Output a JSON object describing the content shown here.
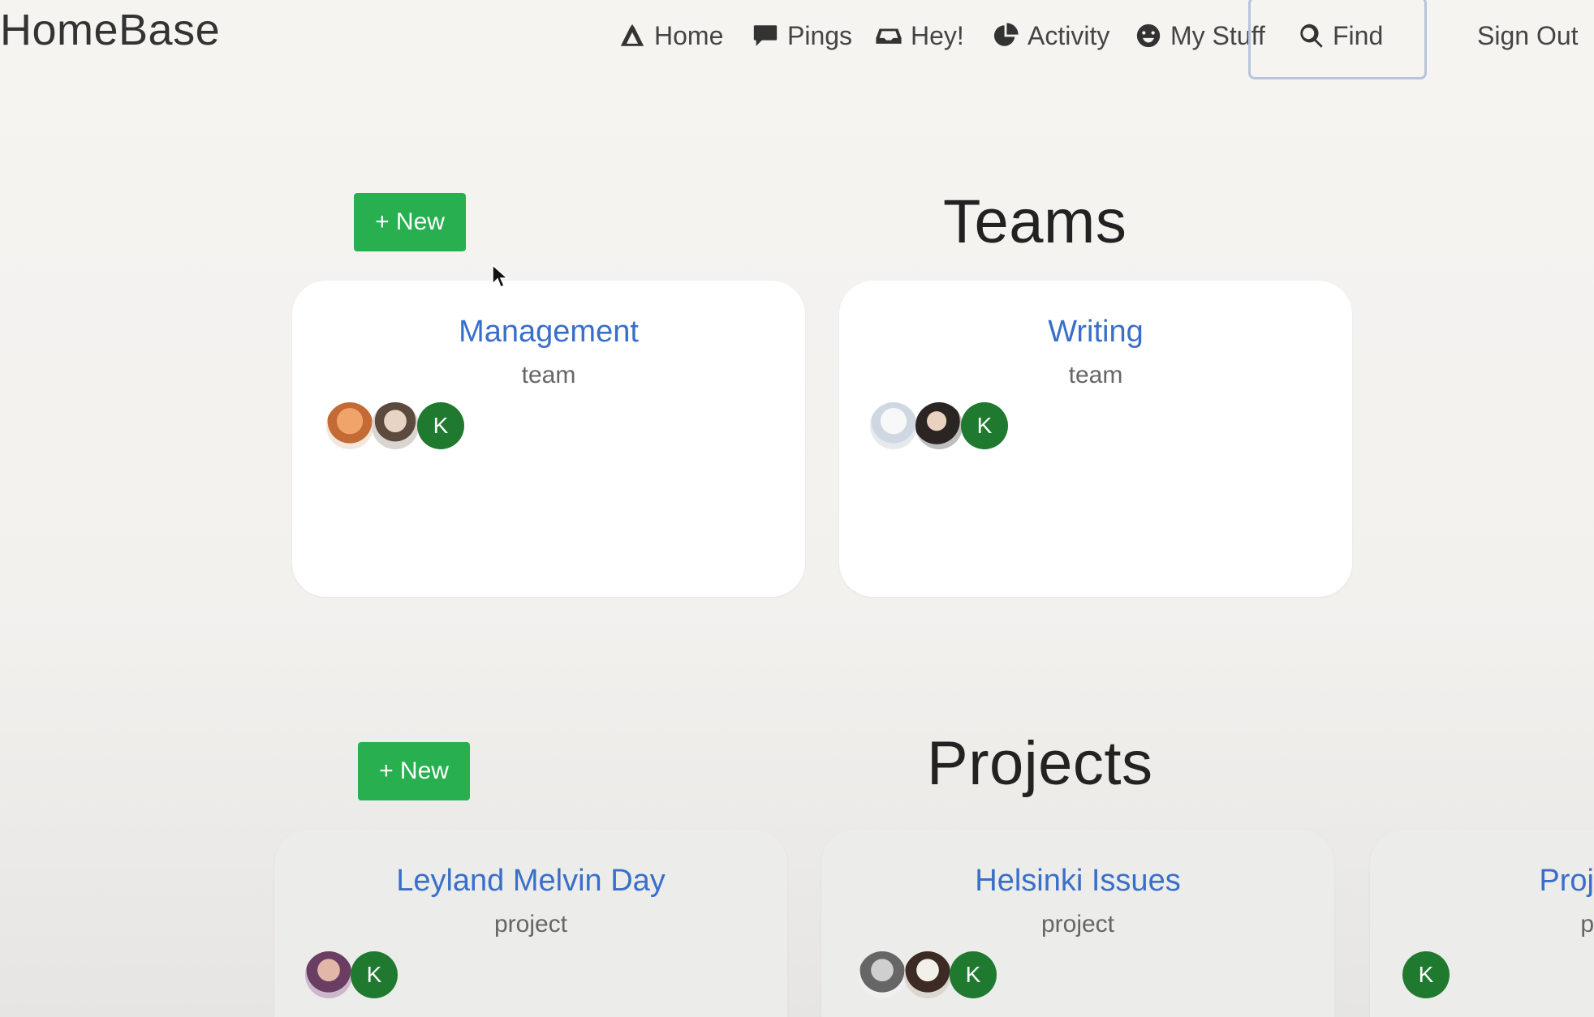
{
  "brand": "HomeBase",
  "nav": [
    {
      "label": "Home",
      "icon": "tent-icon"
    },
    {
      "label": "Pings",
      "icon": "chat-bubble-icon"
    },
    {
      "label": "Hey!",
      "icon": "inbox-icon"
    },
    {
      "label": "Activity",
      "icon": "pie-chart-icon"
    },
    {
      "label": "My Stuff",
      "icon": "smiley-icon"
    },
    {
      "label": "Find",
      "icon": "search-icon"
    }
  ],
  "sign_out": "Sign Out",
  "teams": {
    "title": "Teams",
    "new_label": "+ New",
    "cards": [
      {
        "title": "Management",
        "type": "team",
        "initial": "K"
      },
      {
        "title": "Writing",
        "type": "team",
        "initial": "K"
      }
    ]
  },
  "projects": {
    "title": "Projects",
    "new_label": "+ New",
    "cards": [
      {
        "title": "Leyland Melvin Day",
        "type": "project",
        "initial": "K"
      },
      {
        "title": "Helsinki Issues",
        "type": "project",
        "initial": "K"
      },
      {
        "title": "Proj",
        "type": "p",
        "initial": "K"
      }
    ]
  },
  "colors": {
    "accent_green": "#28b050",
    "link_blue": "#3a6fc9",
    "avatar_green": "#1f7a2f"
  }
}
